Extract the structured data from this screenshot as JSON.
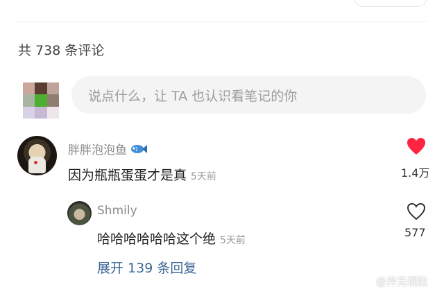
{
  "comments": {
    "count_text": "共 738 条评论",
    "input_placeholder": "说点什么，让 TA 也认识看笔记的你"
  },
  "comment1": {
    "username": "胖胖泡泡鱼",
    "badge_icon": "fish-icon",
    "text": "因为瓶瓶蛋蛋才是真",
    "time": "5天前",
    "likes": "1.4万",
    "liked": true,
    "like_color": "#ff2442"
  },
  "reply1": {
    "username": "Shmily",
    "text": "哈哈哈哈哈哈这个绝",
    "time": "5天前",
    "likes": "577",
    "liked": false
  },
  "expand_replies": "展开 139 条回复",
  "watermark": "@弃无视肚",
  "colors": {
    "link": "#3e6796",
    "muted": "#8a8a8a",
    "input_bg": "#f4f4f4",
    "heart": "#ff2442"
  }
}
